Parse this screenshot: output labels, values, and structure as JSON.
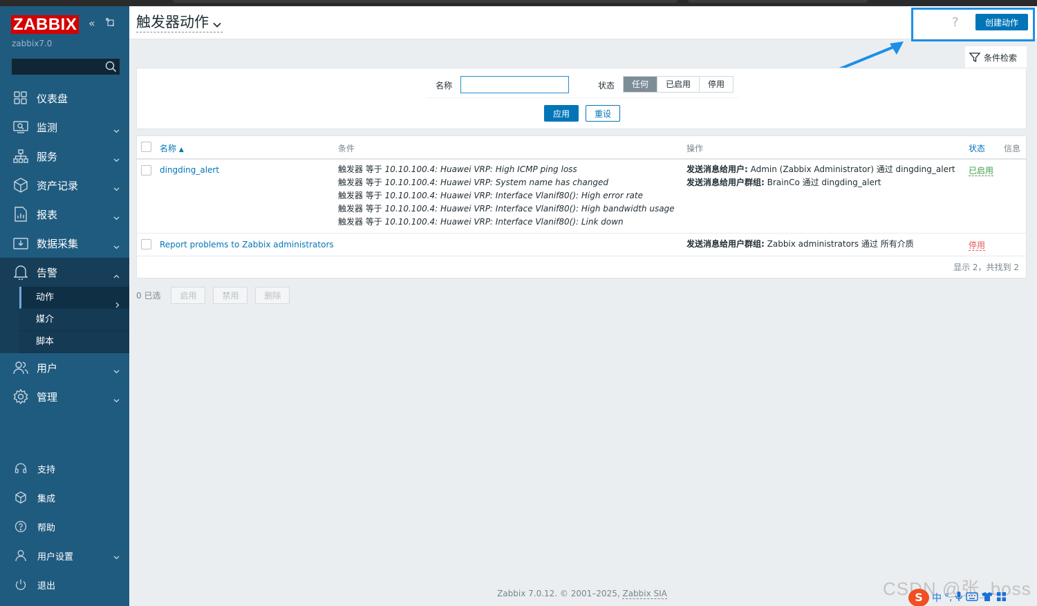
{
  "sidebar": {
    "logo": "ZABBIX",
    "server_name": "zabbix7.0",
    "menu": [
      {
        "label": "仪表盘",
        "icon": "dashboard-icon"
      },
      {
        "label": "监测",
        "icon": "monitoring-icon"
      },
      {
        "label": "服务",
        "icon": "services-icon"
      },
      {
        "label": "资产记录",
        "icon": "inventory-icon"
      },
      {
        "label": "报表",
        "icon": "reports-icon"
      },
      {
        "label": "数据采集",
        "icon": "data-collection-icon"
      },
      {
        "label": "告警",
        "icon": "alerts-icon"
      }
    ],
    "submenu": [
      {
        "label": "动作"
      },
      {
        "label": "媒介"
      },
      {
        "label": "脚本"
      }
    ],
    "menu_after": [
      {
        "label": "用户",
        "icon": "users-icon"
      },
      {
        "label": "管理",
        "icon": "administration-icon"
      }
    ],
    "bottom": [
      {
        "label": "支持",
        "icon": "support-icon"
      },
      {
        "label": "集成",
        "icon": "integrations-icon"
      },
      {
        "label": "帮助",
        "icon": "help-icon"
      },
      {
        "label": "用户设置",
        "icon": "user-settings-icon"
      },
      {
        "label": "退出",
        "icon": "sign-out-icon"
      }
    ]
  },
  "header": {
    "title": "触发器动作",
    "help": "?",
    "create_button": "创建动作",
    "filter_tab": "条件检索"
  },
  "filter": {
    "name_label": "名称",
    "name_value": "",
    "status_label": "状态",
    "status_options": [
      "任何",
      "已启用",
      "停用"
    ],
    "status_selected": "任何",
    "apply": "应用",
    "reset": "重设"
  },
  "table": {
    "columns": {
      "name": "名称",
      "conditions": "条件",
      "operations": "操作",
      "status": "状态",
      "info": "信息"
    },
    "sort_indicator": "▲",
    "rows": [
      {
        "name": "dingding_alert",
        "conditions": [
          {
            "prefix": "触发器 等于 ",
            "value": "10.10.100.4: Huawei VRP: High ICMP ping loss"
          },
          {
            "prefix": "触发器 等于 ",
            "value": "10.10.100.4: Huawei VRP: System name has changed"
          },
          {
            "prefix": "触发器 等于 ",
            "value": "10.10.100.4: Huawei VRP: Interface Vlanif80(): High error rate"
          },
          {
            "prefix": "触发器 等于 ",
            "value": "10.10.100.4: Huawei VRP: Interface Vlanif80(): High bandwidth usage"
          },
          {
            "prefix": "触发器 等于 ",
            "value": "10.10.100.4: Huawei VRP: Interface Vlanif80(): Link down"
          }
        ],
        "operations": [
          {
            "label": "发送消息给用户:",
            "text": " Admin (Zabbix Administrator) 通过 dingding_alert"
          },
          {
            "label": "发送消息给用户群组:",
            "text": " BrainCo 通过 dingding_alert"
          }
        ],
        "status": "已启用"
      },
      {
        "name": "Report problems to Zabbix administrators",
        "conditions": [],
        "operations": [
          {
            "label": "发送消息给用户群组:",
            "text": " Zabbix administrators 通过 所有介质"
          }
        ],
        "status": "停用"
      }
    ],
    "count_text": "显示 2，共找到 2"
  },
  "mass_actions": {
    "selected": "0 已选",
    "enable": "启用",
    "disable": "禁用",
    "delete": "删除"
  },
  "footer": {
    "text": "Zabbix 7.0.12. © 2001–2025, ",
    "company": "Zabbix SIA"
  },
  "watermark": "CSDN @张_boss",
  "ime": {
    "lang": "中"
  },
  "colors": {
    "sidebar": "#1f5b7f",
    "brand_red": "#d40000",
    "primary": "#0275b8",
    "enabled": "#429e47",
    "disabled": "#e45959",
    "annotation": "#1b8fe8"
  }
}
